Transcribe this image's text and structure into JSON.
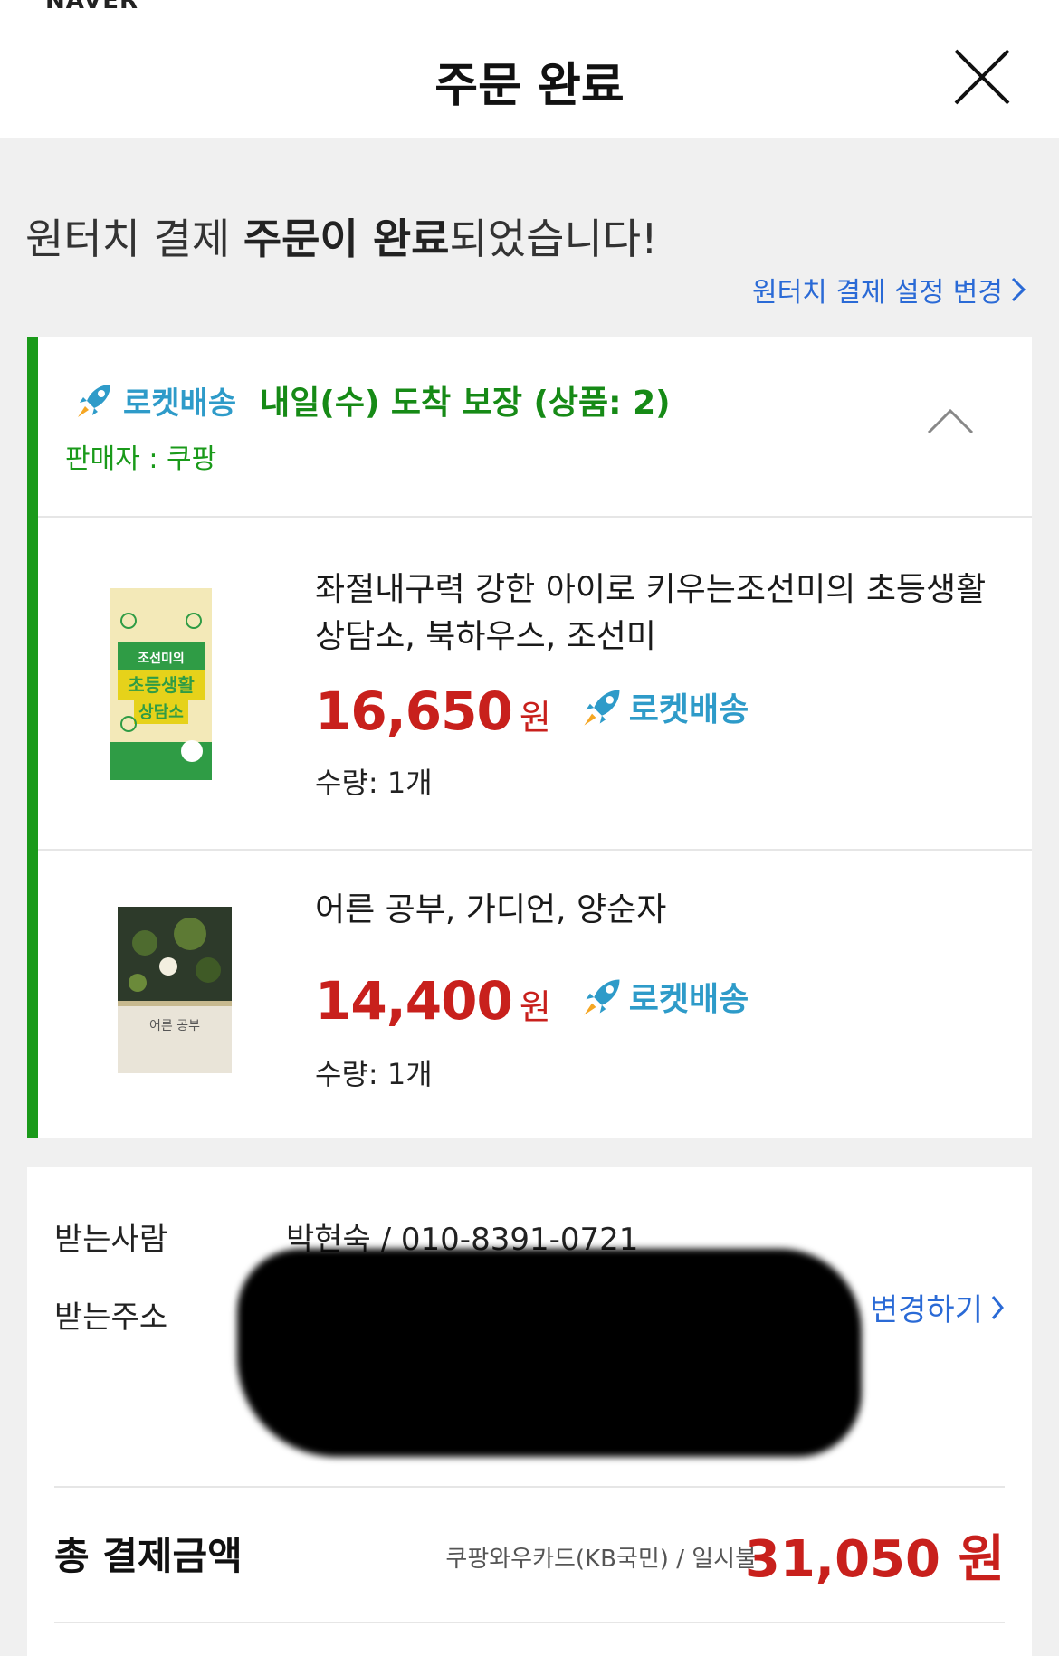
{
  "topbar": {
    "brand": "NAVER",
    "title": "주문 완료"
  },
  "headline": {
    "part1": "원터치 결제 ",
    "bold": "주문이 완료",
    "part2": "되었습니다!"
  },
  "settings_link": "원터치 결제 설정 변경",
  "shipment": {
    "rocket_label": "로켓배송",
    "arrival": "내일(수) 도착 보장 (상품: 2)",
    "seller": "판매자 : 쿠팡"
  },
  "products": [
    {
      "title": "좌절내구력 강한 아이로 키우는조선미의 초등생활 상담소, 북하우스, 조선미",
      "price": "16,650",
      "currency": "원",
      "badge": "로켓배송",
      "qty": "수량: 1개",
      "cover_text": "조선미의 초등생활 상담소"
    },
    {
      "title": "어른 공부, 가디언, 양순자",
      "price": "14,400",
      "currency": "원",
      "badge": "로켓배송",
      "qty": "수량: 1개",
      "cover_text": "어른 공부"
    }
  ],
  "recipient": {
    "name_label": "받는사람",
    "name_value": "박현숙 / 010-8391-0721",
    "address_label": "받는주소",
    "change_link": "변경하기"
  },
  "total": {
    "label": "총 결제금액",
    "method": "쿠팡와우카드(KB국민) / 일시불",
    "amount": "31,050 원"
  },
  "colors": {
    "accent_green": "#1a9a1a",
    "link_blue": "#2a6ad6",
    "price_red": "#c8201c",
    "rocket_blue": "#2e9bc9"
  }
}
